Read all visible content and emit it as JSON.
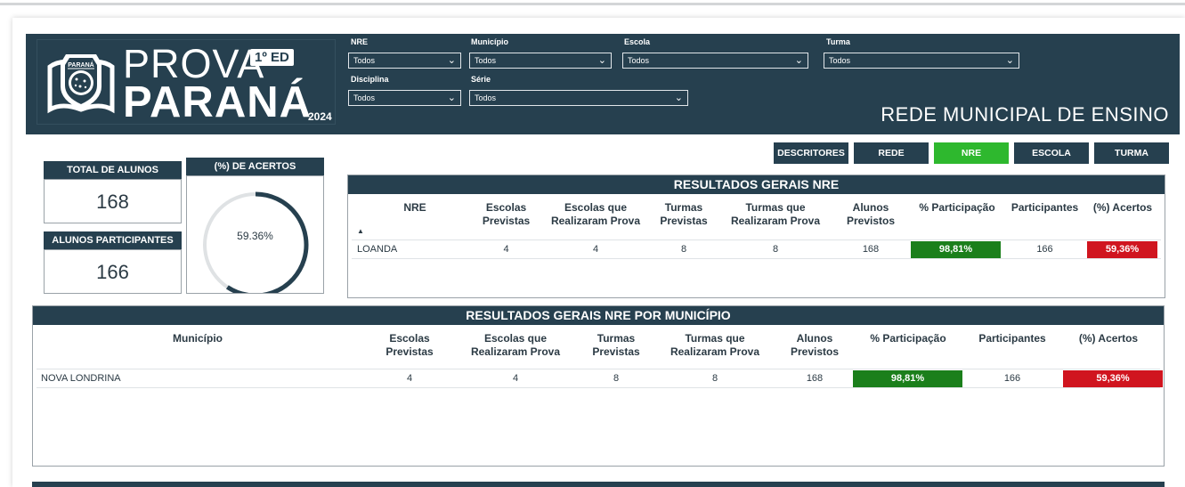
{
  "logo": {
    "prova": "PROVA",
    "edition": "1º ED",
    "parana": "PARANÁ",
    "year": "2024",
    "emblem_text": "PARANÁ"
  },
  "filters": {
    "nre": {
      "label": "NRE",
      "value": "Todos"
    },
    "municipio": {
      "label": "Município",
      "value": "Todos"
    },
    "escola": {
      "label": "Escola",
      "value": "Todos"
    },
    "turma": {
      "label": "Turma",
      "value": "Todos"
    },
    "disciplina": {
      "label": "Disciplina",
      "value": "Todos"
    },
    "serie": {
      "label": "Série",
      "value": "Todos"
    }
  },
  "header_title": "REDE MUNICIPAL DE ENSINO",
  "tabs": {
    "descritores": "DESCRITORES",
    "rede": "REDE",
    "nre": "NRE",
    "escola": "ESCOLA",
    "turma": "TURMA",
    "active": "NRE"
  },
  "kpis": {
    "total_alunos": {
      "label": "TOTAL DE ALUNOS",
      "value": "168"
    },
    "alunos_participantes": {
      "label": "ALUNOS PARTICIPANTES",
      "value": "166"
    },
    "acertos": {
      "label": "(%) DE ACERTOS",
      "value": "59.36%",
      "fraction": 0.5936
    }
  },
  "table_nre": {
    "title": "RESULTADOS GERAIS NRE",
    "headers": {
      "nre": "NRE",
      "escolas_previstas": "Escolas Previstas",
      "escolas_realizaram": "Escolas que Realizaram Prova",
      "turmas_previstas": "Turmas Previstas",
      "turmas_realizaram": "Turmas que Realizaram Prova",
      "alunos_previstos": "Alunos Previstos",
      "participacao": "% Participação",
      "participantes": "Participantes",
      "acertos": "(%) Acertos"
    },
    "row": {
      "nre": "LOANDA",
      "escolas_previstas": "4",
      "escolas_realizaram": "4",
      "turmas_previstas": "8",
      "turmas_realizaram": "8",
      "alunos_previstos": "168",
      "participacao": "98,81%",
      "participantes": "166",
      "acertos": "59,36%"
    }
  },
  "table_municipio": {
    "title": "RESULTADOS GERAIS NRE POR MUNICÍPIO",
    "headers": {
      "municipio": "Município",
      "escolas_previstas": "Escolas Previstas",
      "escolas_realizaram": "Escolas que Realizaram Prova",
      "turmas_previstas": "Turmas Previstas",
      "turmas_realizaram": "Turmas que Realizaram Prova",
      "alunos_previstos": "Alunos Previstos",
      "participacao": "% Participação",
      "participantes": "Participantes",
      "acertos": "(%) Acertos"
    },
    "row": {
      "municipio": "NOVA LONDRINA",
      "escolas_previstas": "4",
      "escolas_realizaram": "4",
      "turmas_previstas": "8",
      "turmas_realizaram": "8",
      "alunos_previstos": "168",
      "participacao": "98,81%",
      "participantes": "166",
      "acertos": "59,36%"
    }
  },
  "colors": {
    "header_bg": "#26404f",
    "active_tab": "#2eb82e",
    "participation_green": "#1b7f1b",
    "accuracy_red": "#d0151f"
  }
}
